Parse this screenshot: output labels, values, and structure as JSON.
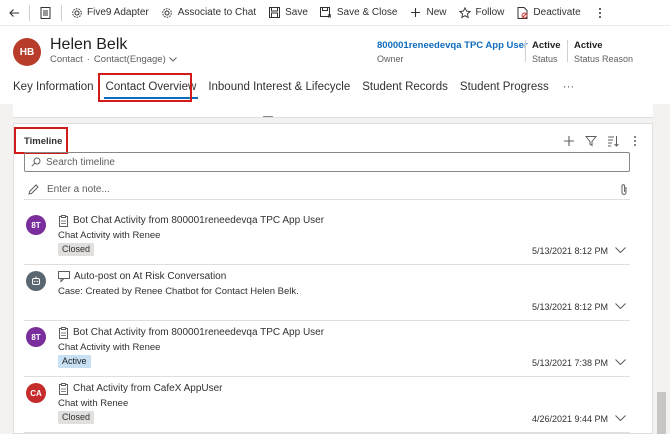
{
  "commandbar": {
    "items": [
      {
        "label": "",
        "icon": "back-arrow-icon"
      },
      {
        "label": "",
        "icon": "record-page-icon"
      },
      {
        "label": "Five9 Adapter",
        "icon": "gear-icon"
      },
      {
        "label": "Associate to Chat",
        "icon": "gear-icon"
      },
      {
        "label": "Save",
        "icon": "save-icon"
      },
      {
        "label": "Save & Close",
        "icon": "save-close-icon"
      },
      {
        "label": "New",
        "icon": "plus-icon"
      },
      {
        "label": "Follow",
        "icon": "star-icon"
      },
      {
        "label": "Deactivate",
        "icon": "deactivate-icon"
      },
      {
        "label": "",
        "icon": "more-vertical-icon"
      }
    ]
  },
  "record": {
    "initials": "HB",
    "name": "Helen Belk",
    "entity": "Contact",
    "form": "Contact(Engage)",
    "owner_value": "800001reneedevqa TPC App User",
    "owner_label": "Owner",
    "status_value": "Active",
    "status_label": "Status",
    "status_reason_value": "Active",
    "status_reason_label": "Status Reason",
    "avatar_color": "#b83c2a"
  },
  "tabs": [
    {
      "label": "Key Information"
    },
    {
      "label": "Contact Overview"
    },
    {
      "label": "Inbound Interest & Lifecycle"
    },
    {
      "label": "Student Records"
    },
    {
      "label": "Student Progress"
    },
    {
      "label": "···"
    }
  ],
  "timeline": {
    "title": "Timeline",
    "search_placeholder": "Search timeline",
    "note_placeholder": "Enter a note...",
    "items": [
      {
        "initials": "8T",
        "avatar_color": "#7a2e9e",
        "type_icon": "activity-icon",
        "title": "Bot Chat Activity from 800001reneedevqa TPC App User",
        "desc": "Chat Activity with Renee",
        "badge": "Closed",
        "date": "5/13/2021 8:12 PM"
      },
      {
        "initials": "",
        "avatar_color": "#5b6770",
        "type_icon": "post-icon",
        "title": "Auto-post on At Risk Conversation",
        "desc": "Case: Created by Renee Chatbot for Contact Helen Belk.",
        "badge": "",
        "date": "5/13/2021 8:12 PM"
      },
      {
        "initials": "8T",
        "avatar_color": "#7a2e9e",
        "type_icon": "activity-icon",
        "title": "Bot Chat Activity from 800001reneedevqa TPC App User",
        "desc": "Chat Activity with Renee",
        "badge": "Active",
        "date": "5/13/2021 7:38 PM"
      },
      {
        "initials": "CA",
        "avatar_color": "#c62c2c",
        "type_icon": "activity-icon",
        "title": "Chat Activity from CafeX AppUser",
        "desc": "Chat with Renee",
        "badge": "Closed",
        "date": "4/26/2021 9:44 PM"
      }
    ]
  },
  "colors": {
    "accent": "#0f6cbd",
    "highlight": "#d11b1b"
  }
}
